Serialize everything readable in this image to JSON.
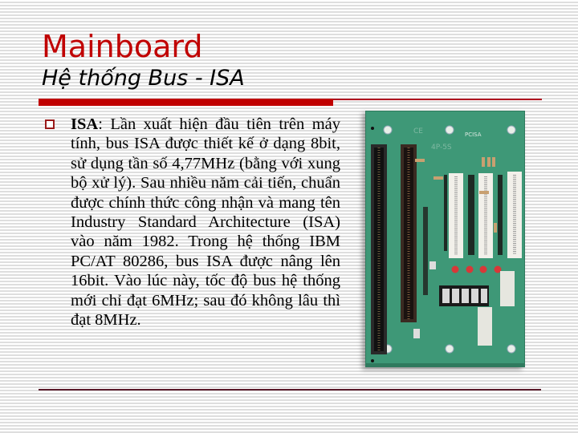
{
  "slide": {
    "title": "Mainboard",
    "subtitle": "Hệ thống Bus - ISA",
    "accent_color": "#c00000",
    "bullets": [
      {
        "icon": "hollow-square-bullet-icon",
        "term": "ISA",
        "text": ": Lần xuất hiện đầu tiên trên máy tính, bus ISA được thiết kế ở dạng 8bit, sử dụng tần số 4,77MHz (bằng với xung bộ xử lý). Sau nhiều năm cải tiến, chuẩn được chính thức công nhận và mang tên Industry Standard Architecture (ISA) vào năm 1982. Trong hệ thống IBM PC/AT 80286, bus ISA được nâng lên 16bit. Vào lúc này, tốc độ bus hệ thống mới chỉ đạt 6MHz; sau đó không lâu thì đạt 8MHz."
      }
    ],
    "image": {
      "description": "ISA/PCI backplane board photo",
      "board_labels": [
        "CE",
        "PCISA",
        "4P-5S"
      ]
    }
  }
}
